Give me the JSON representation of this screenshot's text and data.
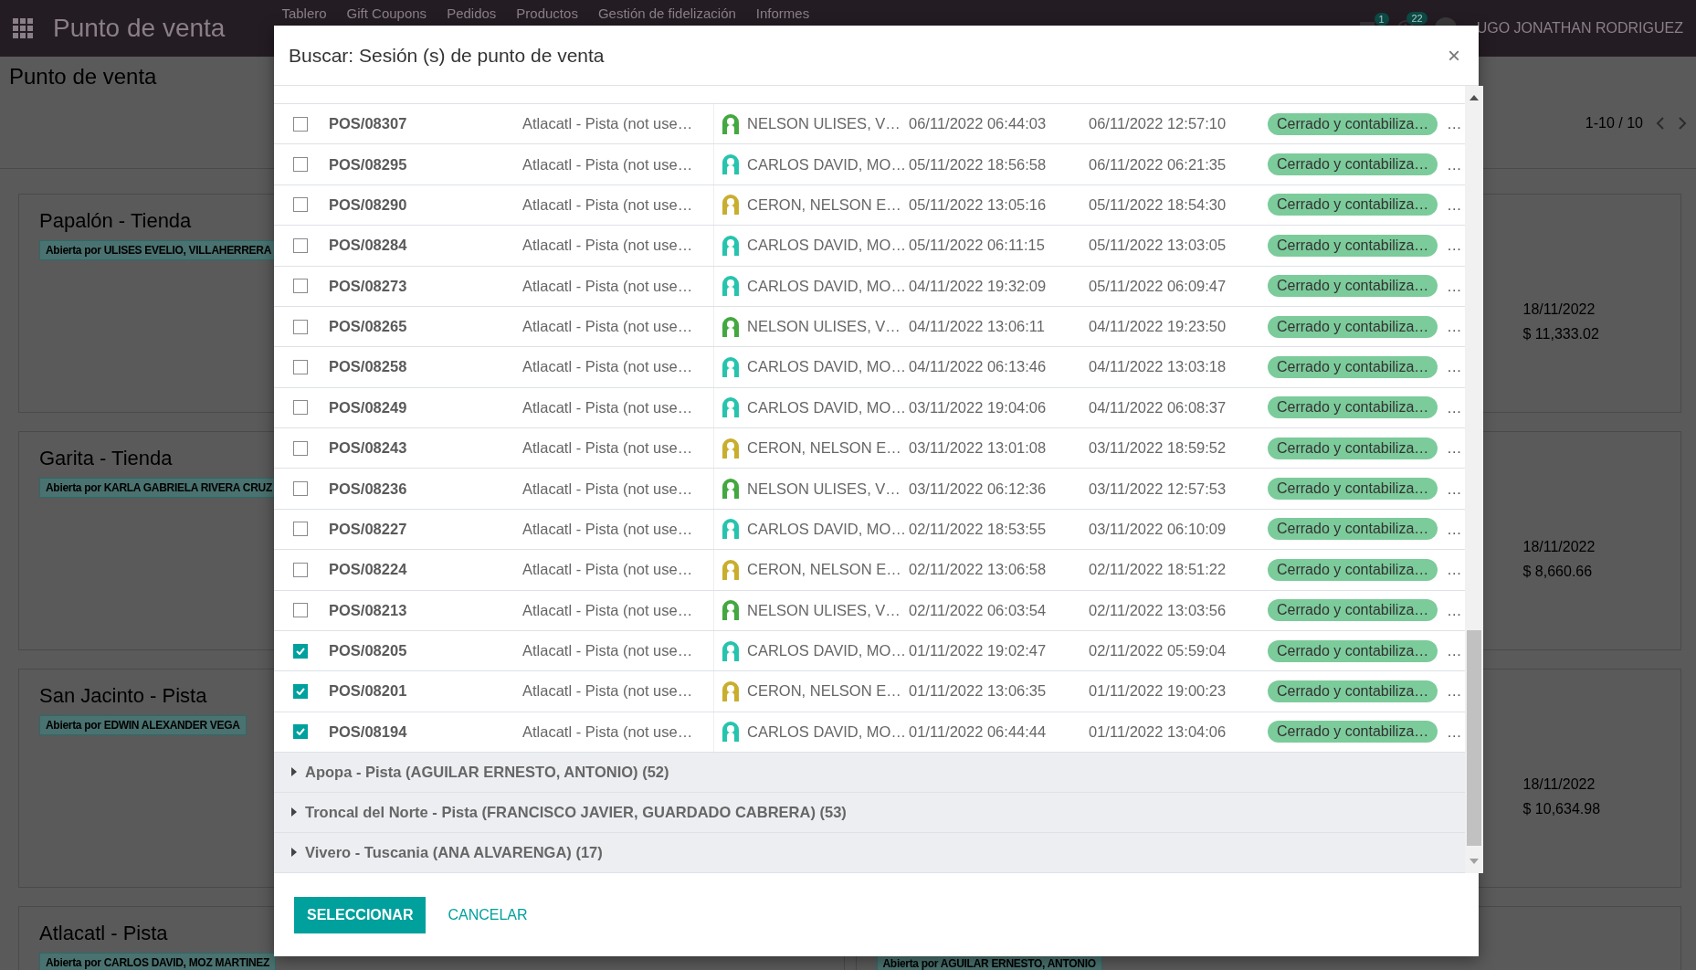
{
  "navbar": {
    "app_title": "Punto de venta",
    "menu": [
      "Tablero",
      "Gift Coupons",
      "Pedidos",
      "Productos",
      "Gestión de fidelización",
      "Informes"
    ],
    "messages_badge": "1",
    "activities_badge": "22",
    "user_name": "UGO JONATHAN RODRIGUEZ"
  },
  "control_panel": {
    "breadcrumb": "Punto de venta",
    "pager": "1-10 / 10"
  },
  "kanban": {
    "left_cards": [
      {
        "name": "Papalón - Tienda",
        "badge": "Abierta por ULISES EVELIO, VILLAHERRERA"
      },
      {
        "name": "Garita - Tienda",
        "badge": "Abierta por KARLA GABRIELA RIVERA CRUZ"
      },
      {
        "name": "San Jacinto - Pista",
        "badge": "Abierta por EDWIN ALEXANDER VEGA"
      },
      {
        "name": "Atlacatl - Pista",
        "badge": "Abierta por CARLOS DAVID, MOZ MARTINEZ"
      }
    ],
    "right_cards": [
      {
        "date": "18/11/2022",
        "amount": "$ 11,333.02"
      },
      {
        "date": "18/11/2022",
        "amount": "$ 8,660.66"
      },
      {
        "date": "18/11/2022",
        "amount": "$ 10,634.98"
      },
      {
        "badge": "Abierta por AGUILAR ERNESTO, ANTONIO"
      }
    ]
  },
  "dialog": {
    "title": "Buscar: Sesión (s) de punto de venta",
    "close": "×",
    "rows": [
      {
        "name": "POS/08307",
        "config": "Atlacatl - Pista (not use…",
        "user": "NELSON ULISES, V…",
        "color": "#43a83f",
        "start": "06/11/2022 06:44:03",
        "end": "06/11/2022 12:57:10",
        "state": "Cerrado y contabiliza…",
        "column_8": "…",
        "checked": false
      },
      {
        "name": "POS/08295",
        "config": "Atlacatl - Pista (not use…",
        "user": "CARLOS DAVID, MO…",
        "color": "#26c4ad",
        "start": "05/11/2022 18:56:58",
        "end": "06/11/2022 06:21:35",
        "state": "Cerrado y contabiliza…",
        "column_8": "…",
        "checked": false
      },
      {
        "name": "POS/08290",
        "config": "Atlacatl - Pista (not use…",
        "user": "CERON, NELSON E…",
        "color": "#c9ae2e",
        "start": "05/11/2022 13:05:16",
        "end": "05/11/2022 18:54:30",
        "state": "Cerrado y contabiliza…",
        "column_8": "…",
        "checked": false
      },
      {
        "name": "POS/08284",
        "config": "Atlacatl - Pista (not use…",
        "user": "CARLOS DAVID, MO…",
        "color": "#26c4ad",
        "start": "05/11/2022 06:11:15",
        "end": "05/11/2022 13:03:05",
        "state": "Cerrado y contabiliza…",
        "column_8": "…",
        "checked": false
      },
      {
        "name": "POS/08273",
        "config": "Atlacatl - Pista (not use…",
        "user": "CARLOS DAVID, MO…",
        "color": "#26c4ad",
        "start": "04/11/2022 19:32:09",
        "end": "05/11/2022 06:09:47",
        "state": "Cerrado y contabiliza…",
        "column_8": "…",
        "checked": false
      },
      {
        "name": "POS/08265",
        "config": "Atlacatl - Pista (not use…",
        "user": "NELSON ULISES, V…",
        "color": "#43a83f",
        "start": "04/11/2022 13:06:11",
        "end": "04/11/2022 19:23:50",
        "state": "Cerrado y contabiliza…",
        "column_8": "…",
        "checked": false
      },
      {
        "name": "POS/08258",
        "config": "Atlacatl - Pista (not use…",
        "user": "CARLOS DAVID, MO…",
        "color": "#26c4ad",
        "start": "04/11/2022 06:13:46",
        "end": "04/11/2022 13:03:18",
        "state": "Cerrado y contabiliza…",
        "column_8": "…",
        "checked": false
      },
      {
        "name": "POS/08249",
        "config": "Atlacatl - Pista (not use…",
        "user": "CARLOS DAVID, MO…",
        "color": "#26c4ad",
        "start": "03/11/2022 19:04:06",
        "end": "04/11/2022 06:08:37",
        "state": "Cerrado y contabiliza…",
        "column_8": "…",
        "checked": false
      },
      {
        "name": "POS/08243",
        "config": "Atlacatl - Pista (not use…",
        "user": "CERON, NELSON E…",
        "color": "#c9ae2e",
        "start": "03/11/2022 13:01:08",
        "end": "03/11/2022 18:59:52",
        "state": "Cerrado y contabiliza…",
        "column_8": "…",
        "checked": false
      },
      {
        "name": "POS/08236",
        "config": "Atlacatl - Pista (not use…",
        "user": "NELSON ULISES, V…",
        "color": "#43a83f",
        "start": "03/11/2022 06:12:36",
        "end": "03/11/2022 12:57:53",
        "state": "Cerrado y contabiliza…",
        "column_8": "…",
        "checked": false
      },
      {
        "name": "POS/08227",
        "config": "Atlacatl - Pista (not use…",
        "user": "CARLOS DAVID, MO…",
        "color": "#26c4ad",
        "start": "02/11/2022 18:53:55",
        "end": "03/11/2022 06:10:09",
        "state": "Cerrado y contabiliza…",
        "column_8": "…",
        "checked": false
      },
      {
        "name": "POS/08224",
        "config": "Atlacatl - Pista (not use…",
        "user": "CERON, NELSON E…",
        "color": "#c9ae2e",
        "start": "02/11/2022 13:06:58",
        "end": "02/11/2022 18:51:22",
        "state": "Cerrado y contabiliza…",
        "column_8": "…",
        "checked": false
      },
      {
        "name": "POS/08213",
        "config": "Atlacatl - Pista (not use…",
        "user": "NELSON ULISES, V…",
        "color": "#43a83f",
        "start": "02/11/2022 06:03:54",
        "end": "02/11/2022 13:03:56",
        "state": "Cerrado y contabiliza…",
        "column_8": "…",
        "checked": false
      },
      {
        "name": "POS/08205",
        "config": "Atlacatl - Pista (not use…",
        "user": "CARLOS DAVID, MO…",
        "color": "#26c4ad",
        "start": "01/11/2022 19:02:47",
        "end": "02/11/2022 05:59:04",
        "state": "Cerrado y contabiliza…",
        "column_8": "…",
        "checked": true
      },
      {
        "name": "POS/08201",
        "config": "Atlacatl - Pista (not use…",
        "user": "CERON, NELSON E…",
        "color": "#c9ae2e",
        "start": "01/11/2022 13:06:35",
        "end": "01/11/2022 19:00:23",
        "state": "Cerrado y contabiliza…",
        "column_8": "…",
        "checked": true
      },
      {
        "name": "POS/08194",
        "config": "Atlacatl - Pista (not use…",
        "user": "CARLOS DAVID, MO…",
        "color": "#26c4ad",
        "start": "01/11/2022 06:44:44",
        "end": "01/11/2022 13:04:06",
        "state": "Cerrado y contabiliza…",
        "column_8": "…",
        "checked": true
      }
    ],
    "groups": [
      {
        "label": "Apopa - Pista (AGUILAR ERNESTO, ANTONIO) (52)",
        "expanded": false
      },
      {
        "label": "Troncal del Norte - Pista (FRANCISCO JAVIER, GUARDADO CABRERA) (53)",
        "expanded": false
      },
      {
        "label": "Vivero - Tuscania (ANA ALVARENGA) (17)",
        "expanded": false
      }
    ],
    "buttons": [
      {
        "label": "SELECCIONAR",
        "kind": "primary"
      },
      {
        "label": "CANCELAR",
        "kind": "link"
      }
    ]
  }
}
